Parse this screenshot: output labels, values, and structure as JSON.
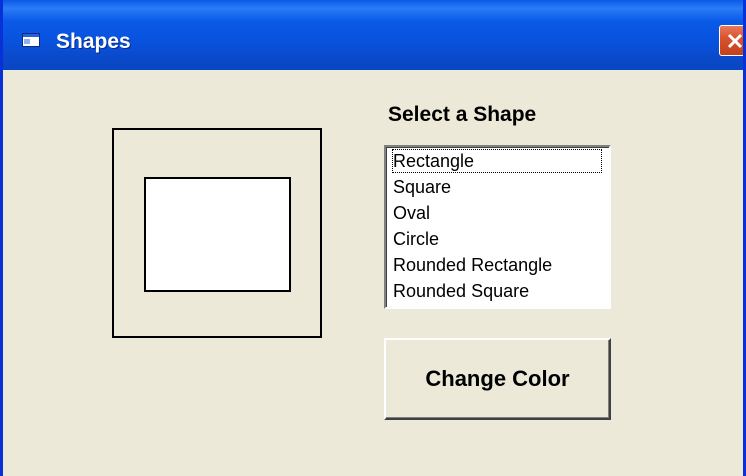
{
  "window": {
    "title": "Shapes",
    "title_icon": "app-window-icon",
    "close_icon": "close-icon"
  },
  "main": {
    "select_label": "Select a Shape",
    "shapes_list": {
      "selected": "Rectangle",
      "items": [
        "Rectangle",
        "Square",
        "Oval",
        "Circle",
        "Rounded Rectangle",
        "Rounded Square"
      ]
    },
    "change_color_button": "Change Color"
  },
  "colors": {
    "titlebar": "#0a5ae8",
    "window_bg": "#ece9d8",
    "close_button": "#d9532f",
    "shape_fill": "#ffffff",
    "shape_border": "#000000"
  }
}
